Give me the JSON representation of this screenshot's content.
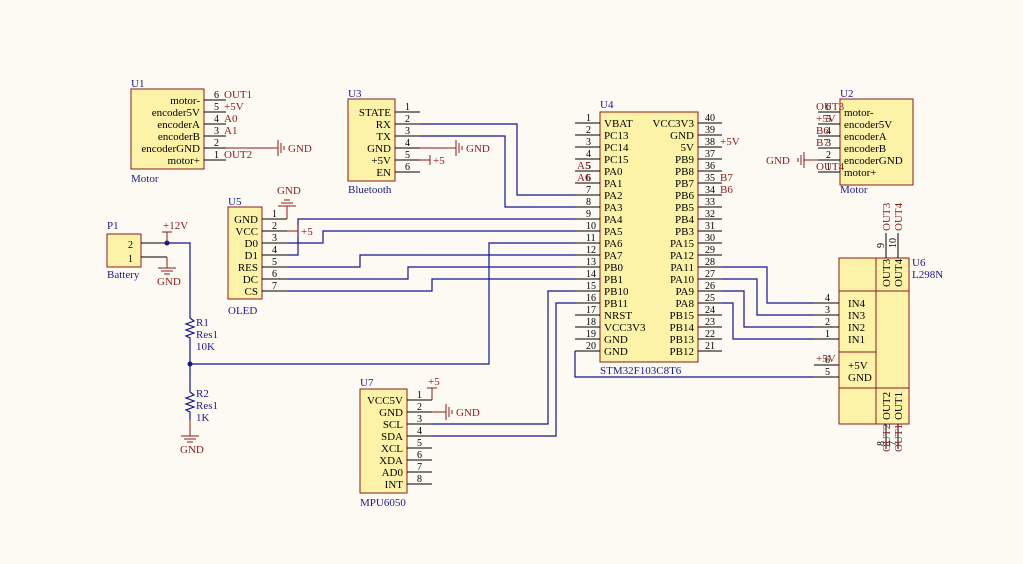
{
  "u1": {
    "ref": "U1",
    "name": "Motor",
    "pins": [
      "motor-",
      "encoder5V",
      "encoderA",
      "encoderB",
      "encoderGND",
      "motor+"
    ],
    "nums": [
      "6",
      "5",
      "4",
      "3",
      "2",
      "1"
    ],
    "nets": [
      "OUT1",
      "+5V",
      "A0",
      "A1",
      "",
      "OUT2"
    ],
    "gnd": "GND"
  },
  "u2": {
    "ref": "U2",
    "name": "Motor",
    "pins": [
      "motor-",
      "encoder5V",
      "encoderA",
      "encoderB",
      "encoderGND",
      "motor+"
    ],
    "nums": [
      "6",
      "5",
      "4",
      "3",
      "2",
      "1"
    ],
    "nets": [
      "OUT3",
      "+5V",
      "B6",
      "B7",
      "",
      "OUT4"
    ],
    "gnd": "GND"
  },
  "u3": {
    "ref": "U3",
    "name": "Bluetooth",
    "pins": [
      "STATE",
      "RX",
      "TX",
      "GND",
      "+5V",
      "EN"
    ],
    "nums": [
      "1",
      "2",
      "3",
      "4",
      "5",
      "6"
    ],
    "gnd": "GND",
    "pwr": "+5"
  },
  "u4": {
    "ref": "U4",
    "name": "STM32F103C8T6",
    "left": [
      "VBAT",
      "PC13",
      "PC14",
      "PC15",
      "PA0",
      "PA1",
      "PA2",
      "PA3",
      "PA4",
      "PA5",
      "PA6",
      "PA7",
      "PB0",
      "PB1",
      "PB10",
      "PB11",
      "NRST",
      "VCC3V3",
      "GND",
      "GND"
    ],
    "right": [
      "VCC3V3",
      "GND",
      "5V",
      "PB9",
      "PB8",
      "PB7",
      "PB6",
      "PB5",
      "PB4",
      "PB3",
      "PA15",
      "PA12",
      "PA11",
      "PA10",
      "PA9",
      "PA8",
      "PB15",
      "PB14",
      "PB13",
      "PB12"
    ],
    "lnums": [
      "1",
      "2",
      "3",
      "4",
      "5",
      "6",
      "7",
      "8",
      "9",
      "10",
      "11",
      "12",
      "13",
      "14",
      "15",
      "16",
      "17",
      "18",
      "19",
      "20"
    ],
    "rnums": [
      "40",
      "39",
      "38",
      "37",
      "36",
      "35",
      "34",
      "33",
      "32",
      "31",
      "30",
      "29",
      "28",
      "27",
      "26",
      "25",
      "24",
      "23",
      "22",
      "21"
    ],
    "netA5": "A5",
    "netA6": "A6",
    "netP5V": "+5V",
    "netB7": "B7",
    "netB6": "B6"
  },
  "u5": {
    "ref": "U5",
    "name": "OLED",
    "pins": [
      "GND",
      "VCC",
      "D0",
      "D1",
      "RES",
      "DC",
      "CS"
    ],
    "nums": [
      "1",
      "2",
      "3",
      "4",
      "5",
      "6",
      "7"
    ],
    "gnd": "GND",
    "pwr": "+5"
  },
  "u6": {
    "ref": "U6",
    "name": "L298N",
    "inputs": [
      "IN4",
      "IN3",
      "IN2",
      "IN1"
    ],
    "innums": [
      "4",
      "3",
      "2",
      "1"
    ],
    "pwr": [
      "+5V",
      "GND"
    ],
    "pwrnums": [
      "6",
      "5"
    ],
    "top": [
      "OUT3",
      "OUT4"
    ],
    "topnums": [
      "9",
      "10"
    ],
    "bot": [
      "OUT2",
      "OUT1"
    ],
    "botnums": [
      "8",
      "7"
    ],
    "netTop": [
      "OUT3",
      "OUT4"
    ],
    "netBot": [
      "OUT2",
      "OUT1"
    ],
    "net5v": "+5V"
  },
  "u7": {
    "ref": "U7",
    "name": "MPU6050",
    "pins": [
      "VCC5V",
      "GND",
      "SCL",
      "SDA",
      "XCL",
      "XDA",
      "AD0",
      "INT"
    ],
    "nums": [
      "1",
      "2",
      "3",
      "4",
      "5",
      "6",
      "7",
      "8"
    ],
    "gnd": "GND",
    "pwr": "+5"
  },
  "p1": {
    "ref": "P1",
    "name": "Battery",
    "nums": [
      "2",
      "1"
    ],
    "pwr": "+12V",
    "gnd": "GND"
  },
  "r1": {
    "ref": "R1",
    "type": "Res1",
    "value": "10K"
  },
  "r2": {
    "ref": "R2",
    "type": "Res1",
    "value": "1K",
    "gnd": "GND"
  }
}
